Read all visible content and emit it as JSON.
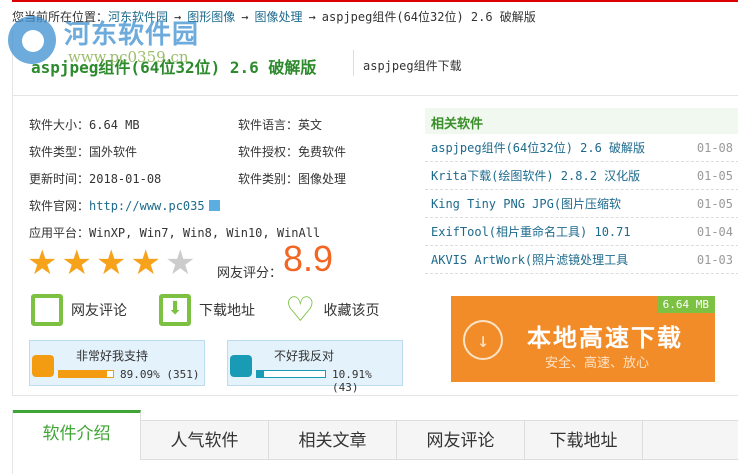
{
  "breadcrumb": {
    "prefix": "您当前所在位置：",
    "items": [
      "河东软件园",
      "图形图像",
      "图像处理"
    ],
    "current": "aspjpeg组件(64位32位) 2.6 破解版",
    "arrow": "→"
  },
  "logo": {
    "name": "河东软件园",
    "url": "www.pc0359.cn"
  },
  "header": {
    "title": "aspjpeg组件(64位32位) 2.6 破解版",
    "subtitle": "aspjpeg组件下载"
  },
  "info": [
    {
      "label": "软件大小：",
      "value": "6.64 MB"
    },
    {
      "label": "软件语言：",
      "value": "英文"
    },
    {
      "label": "软件类型：",
      "value": "国外软件"
    },
    {
      "label": "软件授权：",
      "value": "免费软件"
    },
    {
      "label": "更新时间：",
      "value": "2018-01-08"
    },
    {
      "label": "软件类别：",
      "value": "图像处理"
    },
    {
      "label": "软件官网：",
      "value": "http://www.pc035"
    },
    {
      "label": "应用平台：",
      "value": "WinXP, Win7, Win8, Win10, WinAll"
    }
  ],
  "rating": {
    "stars": 4,
    "max": 5,
    "label": "网友评分：",
    "score": "8.9",
    "star_glyph": "★"
  },
  "actions": [
    "网友评论",
    "下载地址",
    "收藏该页"
  ],
  "votes": [
    {
      "title": "非常好我支持",
      "percent": 89.09,
      "text": "89.09% (351)",
      "color": "#f39c12"
    },
    {
      "title": "不好我反对",
      "percent": 10.91,
      "text": "10.91% (43)",
      "color": "#1a9bb5"
    }
  ],
  "related": {
    "title": "相关软件",
    "items": [
      {
        "name": "aspjpeg组件(64位32位) 2.6 破解版",
        "date": "01-08"
      },
      {
        "name": "Krita下载(绘图软件) 2.8.2 汉化版",
        "date": "01-05"
      },
      {
        "name": "King Tiny PNG JPG(图片压缩软",
        "date": "01-05"
      },
      {
        "name": "ExifTool(相片重命名工具) 10.71",
        "date": "01-04"
      },
      {
        "name": "AKVIS ArtWork(照片滤镜处理工具",
        "date": "01-03"
      }
    ]
  },
  "download": {
    "size": "6.64 MB",
    "main": "本地高速下载",
    "sub": "安全、高速、放心",
    "arrow": "↓"
  },
  "tabs": [
    "软件介绍",
    "人气软件",
    "相关文章",
    "网友评论",
    "下载地址"
  ]
}
